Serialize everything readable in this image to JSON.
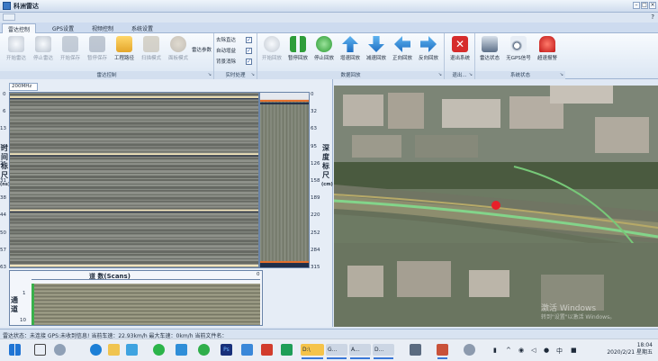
{
  "window": {
    "title": "科洲雷达"
  },
  "tabs": [
    "雷达控制",
    "GPS设置",
    "视频控制",
    "系统设置"
  ],
  "ribbon": {
    "radar_control": {
      "title": "雷达控制",
      "buttons": [
        "开始雷达",
        "停止雷达",
        "开始保存",
        "暂停保存",
        "工程路径",
        "扫描模式",
        "面板模式",
        "雷达参数"
      ]
    },
    "realtime": {
      "title": "实时处理",
      "options": [
        {
          "label": "去除直达",
          "checked": true
        },
        {
          "label": "自动增益",
          "checked": true
        },
        {
          "label": "背景消除",
          "checked": true
        }
      ]
    },
    "playback": {
      "title": "数据回放",
      "buttons": [
        "开始回放",
        "暂停回放",
        "停止回放",
        "增速回放",
        "减速回放",
        "正向回放",
        "反向回放"
      ]
    },
    "exit": {
      "title": "退出...",
      "button": "退出系统"
    },
    "sys_status": {
      "title": "系统状态",
      "buttons": [
        "雷达状态",
        "无GPS信号",
        "超速报警"
      ]
    }
  },
  "radar": {
    "freq_tab": "200MHz",
    "time_axis_label": [
      "时",
      "间",
      "标",
      "尺",
      "(ns)"
    ],
    "depth_axis_label": [
      "深",
      "度",
      "标",
      "尺",
      "(cm)"
    ],
    "time_ticks": [
      "0",
      "6",
      "13",
      "19",
      "25",
      "31",
      "38",
      "44",
      "50",
      "57",
      "63"
    ],
    "depth_ticks": [
      "0",
      "32",
      "63",
      "95",
      "126",
      "158",
      "189",
      "220",
      "252",
      "284",
      "315"
    ],
    "scan_caption": "道 数(Scans)",
    "scan_axis_value": "0",
    "channel_label": [
      "通",
      "道"
    ],
    "channel_ticks": [
      "1",
      "10"
    ]
  },
  "map": {
    "watermark_title": "激活 Windows",
    "watermark_sub": "转到\"设置\"以激活 Windows。"
  },
  "status": {
    "text": "雷达状态：未连接  GPS:未收到信息!  当前车速：22.93km/h  最大车速：0km/h    当前文件名："
  },
  "taskbar": {
    "time": "18:04",
    "date": "2020/2/21 星期五",
    "apps": [
      "D:\\",
      "G...",
      "A...",
      "D..."
    ]
  }
}
